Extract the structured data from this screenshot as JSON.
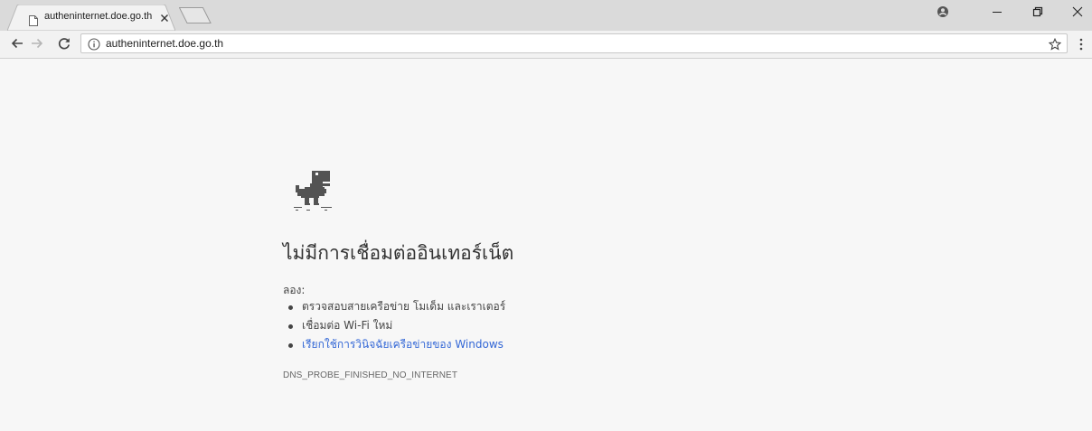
{
  "tab": {
    "title": "autheninternet.doe.go.th",
    "favicon": "page-icon",
    "close_icon": "close-icon"
  },
  "window_controls": {
    "profile_icon": "user-profile-icon",
    "minimize_icon": "minimize-icon",
    "restore_icon": "restore-icon",
    "close_icon": "close-icon"
  },
  "toolbar": {
    "back_icon": "back-arrow-icon",
    "forward_icon": "forward-arrow-icon",
    "reload_icon": "reload-icon",
    "url": "autheninternet.doe.go.th",
    "info_icon": "info-icon",
    "bookmark_icon": "star-icon",
    "menu_icon": "more-vert-icon"
  },
  "error_page": {
    "icon": "offline-dino-icon",
    "title": "ไม่มีการเชื่อมต่ออินเทอร์เน็ต",
    "try_label": "ลอง:",
    "suggestions": [
      "ตรวจสอบสายเครือข่าย โมเด็ม และเราเตอร์",
      "เชื่อมต่อ Wi-Fi ใหม่",
      "เรียกใช้การวินิจฉัยเครือข่ายของ Windows"
    ],
    "error_code": "DNS_PROBE_FINISHED_NO_INTERNET"
  },
  "colors": {
    "page_background": "#f7f7f7",
    "titlebar": "#dadada",
    "link": "#3367d6",
    "text": "#333333"
  }
}
